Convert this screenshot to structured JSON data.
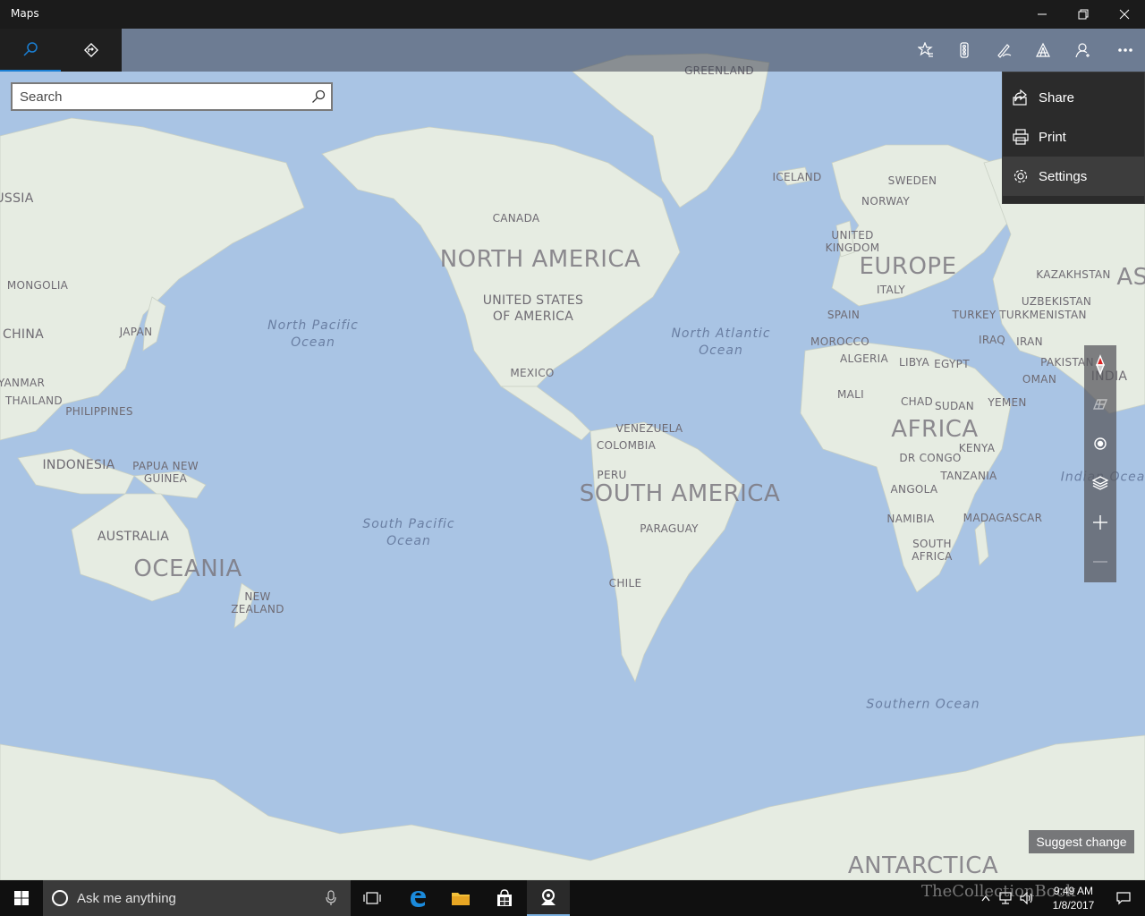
{
  "window": {
    "title": "Maps"
  },
  "nav": {
    "search_icon": "search-icon",
    "directions_icon": "directions-icon"
  },
  "commands": [
    "favorites-icon",
    "traffic-icon",
    "ink-icon",
    "3d-cities-icon",
    "account-icon",
    "more-icon"
  ],
  "search": {
    "placeholder": "Search",
    "value": ""
  },
  "menu": {
    "items": [
      {
        "label": "Share",
        "icon": "share-icon"
      },
      {
        "label": "Print",
        "icon": "print-icon"
      },
      {
        "label": "Settings",
        "icon": "gear-icon"
      }
    ]
  },
  "map": {
    "continents": [
      "NORTH AMERICA",
      "SOUTH AMERICA",
      "EUROPE",
      "AFRICA",
      "OCEANIA",
      "ANTARCTICA",
      "AS"
    ],
    "countries": [
      "GREENLAND",
      "ICELAND",
      "SWEDEN",
      "NORWAY",
      "UNITED KINGDOM",
      "KAZAKHSTAN",
      "UZBEKISTAN",
      "TURKMENISTAN",
      "TURKEY",
      "ITALY",
      "SPAIN",
      "MOROCCO",
      "ALGERIA",
      "LIBYA",
      "EGYPT",
      "IRAQ",
      "IRAN",
      "PAKISTAN",
      "INDIA",
      "OMAN",
      "YEMEN",
      "MALI",
      "CHAD",
      "SUDAN",
      "KENYA",
      "DR CONGO",
      "TANZANIA",
      "ANGOLA",
      "NAMIBIA",
      "MADAGASCAR",
      "SOUTH AFRICA",
      "CANADA",
      "UNITED STATES OF AMERICA",
      "MEXICO",
      "VENEZUELA",
      "COLOMBIA",
      "PERU",
      "PARAGUAY",
      "CHILE",
      "USSIA",
      "MONGOLIA",
      "CHINA",
      "JAPAN",
      "YANMAR",
      "THAILAND",
      "PHILIPPINES",
      "INDONESIA",
      "PAPUA NEW GUINEA",
      "AUSTRALIA",
      "NEW ZEALAND"
    ],
    "oceans": [
      "North Pacific Ocean",
      "North Atlantic Ocean",
      "South Pacific Ocean",
      "Southern Ocean",
      "Indian Ocean"
    ]
  },
  "controls": [
    "compass-icon",
    "tilt-icon",
    "location-icon",
    "layers-icon",
    "zoom-in-icon",
    "zoom-out-icon"
  ],
  "suggest_label": "Suggest change",
  "taskbar": {
    "cortana_placeholder": "Ask me anything",
    "clock_time": "9:49 AM",
    "clock_date": "1/8/2017"
  },
  "watermark": "TheCollectionBook",
  "colors": {
    "ocean": "#a9c4e4",
    "land": "#e6ece2",
    "accent": "#1a7fd4",
    "menu_bg": "#2b2b2b"
  }
}
